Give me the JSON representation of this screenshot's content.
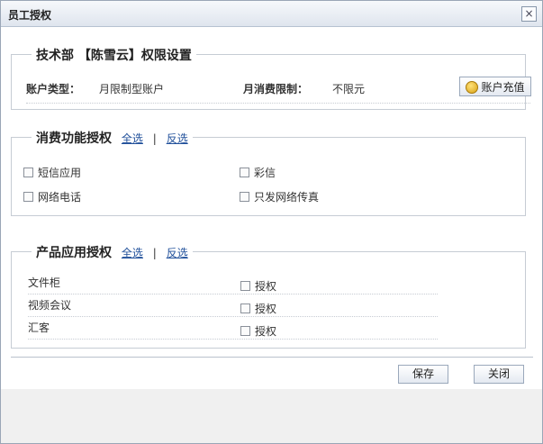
{
  "dialog": {
    "title": "员工授权",
    "close_glyph": "×"
  },
  "account_group": {
    "legend": "技术部 【陈雪云】权限设置",
    "type_label": "账户类型：",
    "type_value": "月限制型账户",
    "limit_label": "月消费限制：",
    "limit_value": "不限元",
    "recharge_label": "账户充值"
  },
  "consume_group": {
    "legend": "消费功能授权",
    "select_all": "全选",
    "separator": "|",
    "invert": "反选",
    "items": [
      {
        "label": "短信应用",
        "checked": false
      },
      {
        "label": "彩信",
        "checked": false
      },
      {
        "label": "网络电话",
        "checked": false
      },
      {
        "label": "只发网络传真",
        "checked": false
      }
    ]
  },
  "product_group": {
    "legend": "产品应用授权",
    "select_all": "全选",
    "separator": "|",
    "invert": "反选",
    "rows": [
      {
        "name": "文件柜",
        "auth_label": "授权",
        "checked": false
      },
      {
        "name": "视频会议",
        "auth_label": "授权",
        "checked": false
      },
      {
        "name": "汇客",
        "auth_label": "授权",
        "checked": false
      }
    ]
  },
  "footer": {
    "save_label": "保存",
    "close_label": "关闭"
  }
}
